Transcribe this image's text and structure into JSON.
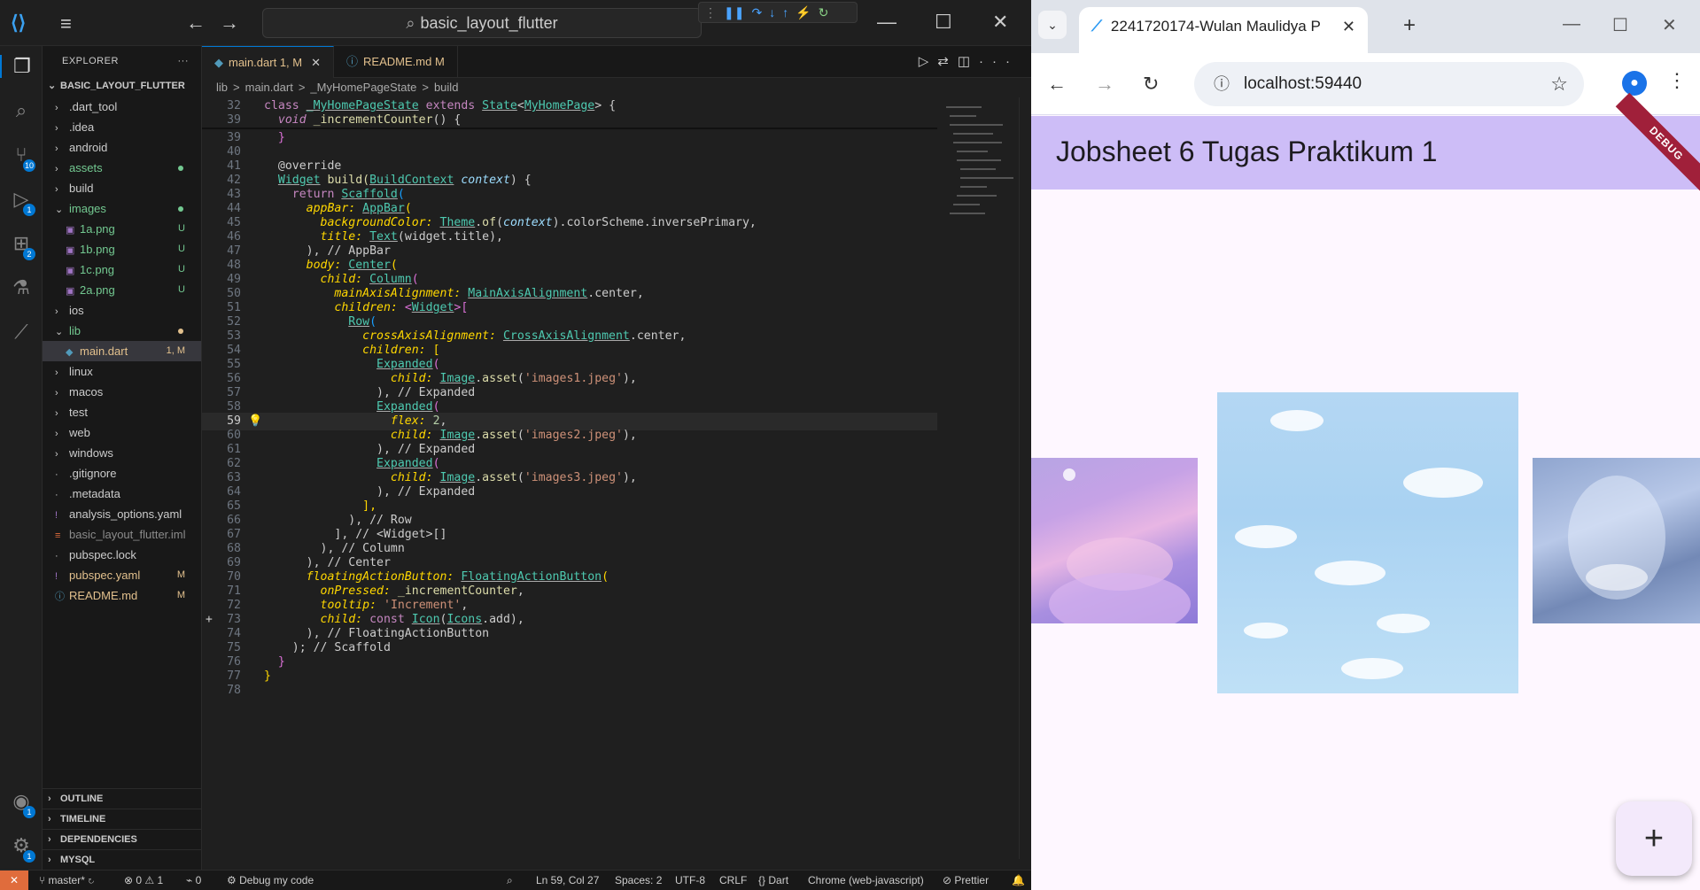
{
  "vscode": {
    "search_text": "basic_layout_flutter",
    "explorer_title": "EXPLORER",
    "project_name": "BASIC_LAYOUT_FLUTTER",
    "tree": [
      {
        "label": ".dart_tool",
        "kind": "folder",
        "status": ""
      },
      {
        "label": ".idea",
        "kind": "folder",
        "status": ""
      },
      {
        "label": "android",
        "kind": "folder",
        "status": ""
      },
      {
        "label": "assets",
        "kind": "folder",
        "status": "dot"
      },
      {
        "label": "build",
        "kind": "folder",
        "status": ""
      },
      {
        "label": "images",
        "kind": "folder-open",
        "status": "dot"
      },
      {
        "label": "1a.png",
        "kind": "image",
        "status": "U"
      },
      {
        "label": "1b.png",
        "kind": "image",
        "status": "U"
      },
      {
        "label": "1c.png",
        "kind": "image",
        "status": "U"
      },
      {
        "label": "2a.png",
        "kind": "image",
        "status": "U"
      },
      {
        "label": "ios",
        "kind": "folder",
        "status": ""
      },
      {
        "label": "lib",
        "kind": "folder-open",
        "status": "dot"
      },
      {
        "label": "main.dart",
        "kind": "dart",
        "status": "1, M"
      },
      {
        "label": "linux",
        "kind": "folder",
        "status": ""
      },
      {
        "label": "macos",
        "kind": "folder",
        "status": ""
      },
      {
        "label": "test",
        "kind": "folder",
        "status": ""
      },
      {
        "label": "web",
        "kind": "folder",
        "status": ""
      },
      {
        "label": "windows",
        "kind": "folder",
        "status": ""
      },
      {
        "label": ".gitignore",
        "kind": "file",
        "status": ""
      },
      {
        "label": ".metadata",
        "kind": "file",
        "status": ""
      },
      {
        "label": "analysis_options.yaml",
        "kind": "yaml",
        "status": ""
      },
      {
        "label": "basic_layout_flutter.iml",
        "kind": "iml",
        "status": ""
      },
      {
        "label": "pubspec.lock",
        "kind": "file",
        "status": ""
      },
      {
        "label": "pubspec.yaml",
        "kind": "yaml",
        "status": "M"
      },
      {
        "label": "README.md",
        "kind": "md",
        "status": "M"
      }
    ],
    "bottom_sections": [
      "OUTLINE",
      "TIMELINE",
      "DEPENDENCIES",
      "MYSQL"
    ],
    "tabs": [
      {
        "label": "main.dart",
        "status": "1, M"
      },
      {
        "label": "README.md",
        "status": "M"
      }
    ],
    "breadcrumbs": [
      "lib",
      ">",
      "main.dart",
      ">",
      "_MyHomePageState",
      ">",
      "build"
    ],
    "status": {
      "branch": "master*",
      "errors": "0",
      "warnings": "1",
      "ports": "0",
      "debug": "Debug my code",
      "position": "Ln 59, Col 27",
      "spaces": "Spaces: 2",
      "encoding": "UTF-8",
      "eol": "CRLF",
      "language": "Dart",
      "device": "Chrome (web-javascript)",
      "formatter": "Prettier"
    },
    "badges": {
      "source_control": "10",
      "run": "1",
      "extensions": "2",
      "accounts": "1",
      "settings": "1"
    }
  },
  "code": {
    "n32": "32",
    "n39": "39",
    "n40": "40",
    "n41": "41",
    "n42": "42",
    "n43": "43",
    "n44": "44",
    "n45": "45",
    "n46": "46",
    "n47": "47",
    "n48": "48",
    "n49": "49",
    "n50": "50",
    "n51": "51",
    "n52": "52",
    "n53": "53",
    "n54": "54",
    "n55": "55",
    "n56": "56",
    "n57": "57",
    "n58": "58",
    "n59": "59",
    "n60": "60",
    "n61": "61",
    "n62": "62",
    "n63": "63",
    "n64": "64",
    "n65": "65",
    "n66": "66",
    "n67": "67",
    "n68": "68",
    "n69": "69",
    "n70": "70",
    "n71": "71",
    "n72": "72",
    "n73": "73",
    "n74": "74",
    "n75": "75",
    "n76": "76",
    "n77": "77",
    "n78": "78",
    "l32_a": "class ",
    "l32_b": "_MyHomePageState",
    "l32_c": " extends ",
    "l32_d": "State",
    "l32_e": "<",
    "l32_f": "MyHomePage",
    "l32_g": "> {",
    "l39_a": "void ",
    "l39_b": "_incrementCounter",
    "l39_c": "() {",
    "l39": "}",
    "l41": "@override",
    "l42_a": "Widget",
    "l42_b": " build(",
    "l42_c": "BuildContext",
    "l42_d": " context",
    "l42_e": ") {",
    "l43_a": "return ",
    "l43_b": "Scaffold",
    "l43_c": "(",
    "l44_a": "appBar: ",
    "l44_b": "AppBar",
    "l44_c": "(",
    "l45_a": "backgroundColor: ",
    "l45_b": "Theme",
    "l45_c": ".",
    "l45_d": "of",
    "l45_e": "(",
    "l45_f": "context",
    "l45_g": ").colorScheme.inversePrimary,",
    "l46_a": "title: ",
    "l46_b": "Text",
    "l46_c": "(widget.title),",
    "l47": "), // AppBar",
    "l48_a": "body: ",
    "l48_b": "Center",
    "l48_c": "(",
    "l49_a": "child: ",
    "l49_b": "Column",
    "l49_c": "(",
    "l50_a": "mainAxisAlignment: ",
    "l50_b": "MainAxisAlignment",
    "l50_c": ".center,",
    "l51_a": "children: ",
    "l51_b": "<",
    "l51_c": "Widget",
    "l51_d": ">[",
    "l52_a": "Row",
    "l52_b": "(",
    "l53_a": "crossAxisAlignment: ",
    "l53_b": "CrossAxisAlignment",
    "l53_c": ".center,",
    "l54_a": "children: ",
    "l54_b": "[",
    "l55_a": "Expanded",
    "l55_b": "(",
    "l56_a": "child: ",
    "l56_b": "Image",
    "l56_c": ".",
    "l56_d": "asset",
    "l56_e": "(",
    "l56_f": "'images1.jpeg'",
    "l56_g": "),",
    "l57": "), // Expanded",
    "l58_a": "Expanded",
    "l58_b": "(",
    "l59_a": "flex: ",
    "l59_b": "2",
    "l59_c": ",",
    "l60_a": "child: ",
    "l60_b": "Image",
    "l60_c": ".",
    "l60_d": "asset",
    "l60_e": "(",
    "l60_f": "'images2.jpeg'",
    "l60_g": "),",
    "l61": "), // Expanded",
    "l62_a": "Expanded",
    "l62_b": "(",
    "l63_a": "child: ",
    "l63_b": "Image",
    "l63_c": ".",
    "l63_d": "asset",
    "l63_e": "(",
    "l63_f": "'images3.jpeg'",
    "l63_g": "),",
    "l64": "), // Expanded",
    "l65": "],",
    "l66": "), // Row",
    "l67": "], // <Widget>[]",
    "l68": "), // Column",
    "l69": "), // Center",
    "l70_a": "floatingActionButton: ",
    "l70_b": "FloatingActionButton",
    "l70_c": "(",
    "l71_a": "onPressed: ",
    "l71_b": "_incrementCounter",
    "l71_c": ",",
    "l72_a": "tooltip: ",
    "l72_b": "'Increment'",
    "l72_c": ",",
    "l73_a": "child: ",
    "l73_b": "const ",
    "l73_c": "Icon",
    "l73_d": "(",
    "l73_e": "Icons",
    "l73_f": ".add),",
    "l74": "), // FloatingActionButton",
    "l75": "); // Scaffold",
    "l76": "}",
    "l77": "}"
  },
  "chrome": {
    "tab_title": "2241720174-Wulan Maulidya P",
    "url": "localhost:59440",
    "app_title": "Jobsheet 6 Tugas Praktikum 1",
    "debug_banner": "DEBUG",
    "fab_symbol": "+"
  }
}
